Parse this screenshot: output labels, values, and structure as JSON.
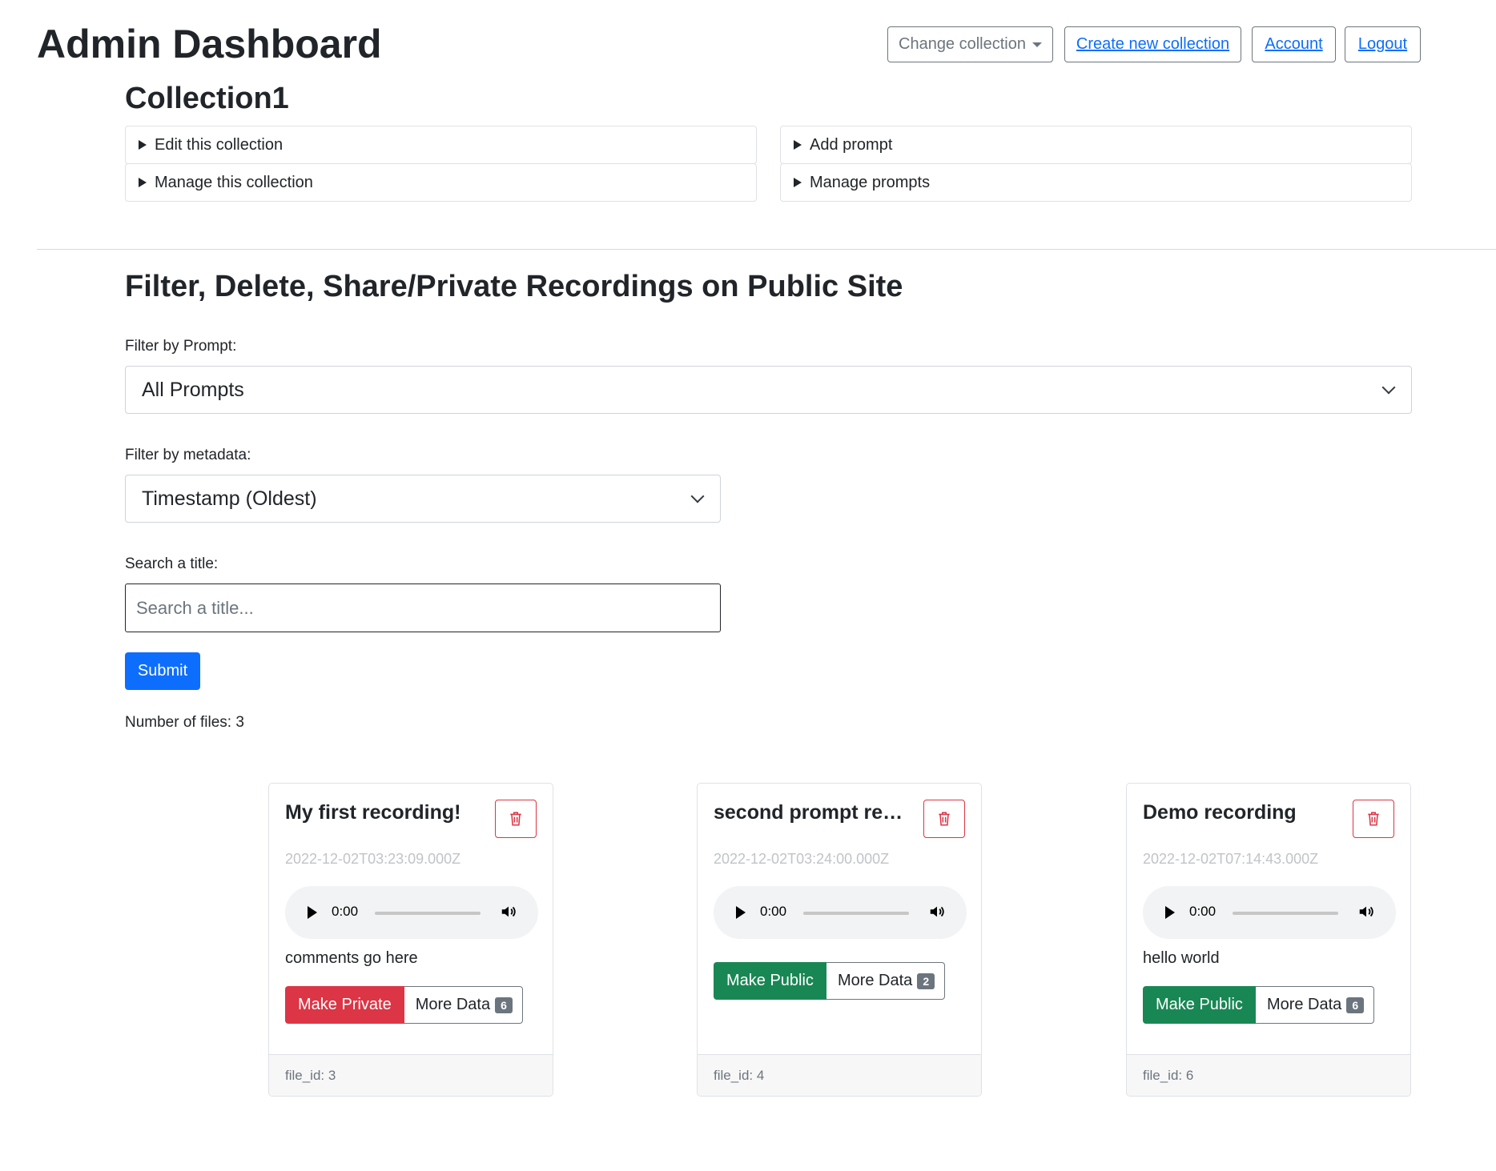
{
  "header": {
    "title": "Admin Dashboard",
    "collection_title": "Collection1",
    "nav": {
      "change_collection": "Change collection",
      "create_new_collection": "Create new collection",
      "account": "Account",
      "logout": "Logout"
    }
  },
  "accordions": {
    "edit_collection": "Edit this collection",
    "manage_collection": "Manage this collection",
    "add_prompt": "Add prompt",
    "manage_prompts": "Manage prompts"
  },
  "filter_section": {
    "title": "Filter, Delete, Share/Private Recordings on Public Site",
    "prompt_label": "Filter by Prompt:",
    "prompt_value": "All Prompts",
    "metadata_label": "Filter by metadata:",
    "metadata_value": "Timestamp (Oldest)",
    "search_label": "Search a title:",
    "search_placeholder": "Search a title...",
    "submit_label": "Submit",
    "file_count_text": "Number of files: 3"
  },
  "colors": {
    "primary": "#0d6efd",
    "danger": "#dc3545",
    "success": "#198754",
    "secondary": "#6c757d"
  },
  "recordings": [
    {
      "title": "My first recording!",
      "timestamp": "2022-12-02T03:23:09.000Z",
      "audio_time": "0:00",
      "comment": "comments go here",
      "toggle_label": "Make Private",
      "toggle_color": "#dc3545",
      "more_label": "More Data",
      "more_count": "6",
      "footer": "file_id: 3",
      "delete_icon": "trash-icon"
    },
    {
      "title": "second prompt recor...",
      "timestamp": "2022-12-02T03:24:00.000Z",
      "audio_time": "0:00",
      "comment": "",
      "toggle_label": "Make Public",
      "toggle_color": "#198754",
      "more_label": "More Data",
      "more_count": "2",
      "footer": "file_id: 4",
      "delete_icon": "trash-icon"
    },
    {
      "title": "Demo recording",
      "timestamp": "2022-12-02T07:14:43.000Z",
      "audio_time": "0:00",
      "comment": "hello world",
      "toggle_label": "Make Public",
      "toggle_color": "#198754",
      "more_label": "More Data",
      "more_count": "6",
      "footer": "file_id: 6",
      "delete_icon": "trash-icon"
    }
  ]
}
